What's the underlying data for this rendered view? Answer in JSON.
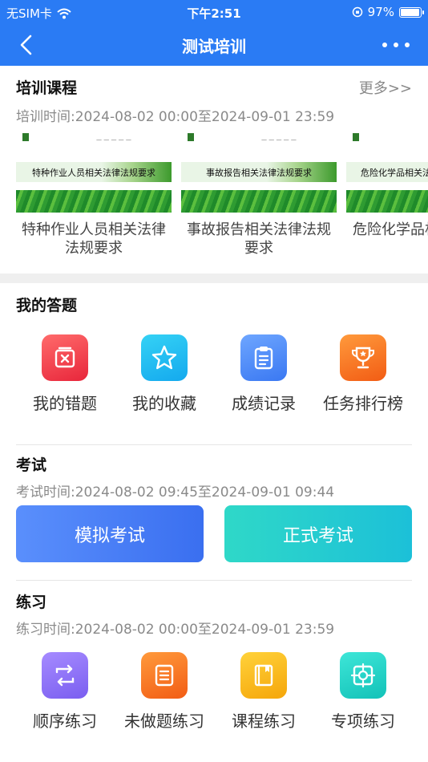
{
  "status_bar": {
    "carrier": "无SIM卡",
    "time": "下午2:51",
    "battery_pct": "97%",
    "battery_level": 0.97
  },
  "nav": {
    "title": "测试培训"
  },
  "training": {
    "title": "培训课程",
    "more_label": "更多>>",
    "time_text": "培训时间:2024-08-02 00:00至2024-09-01 23:59",
    "courses": [
      {
        "poster_title": "特种作业人员相关法律法规要求",
        "name": "特种作业人员相关法律法规要求"
      },
      {
        "poster_title": "事故报告相关法律法规要求",
        "name": "事故报告相关法律法规要求"
      },
      {
        "poster_title": "危险化学品相关法",
        "name": "危险化学品相关法规"
      }
    ]
  },
  "my_answers": {
    "title": "我的答题",
    "items": [
      {
        "label": "我的错题",
        "icon": "wrong-answers-icon",
        "color_from": "#ff6b6b",
        "color_to": "#e8263b"
      },
      {
        "label": "我的收藏",
        "icon": "star-icon",
        "color_from": "#35d2f5",
        "color_to": "#14a9ee"
      },
      {
        "label": "成绩记录",
        "icon": "clipboard-icon",
        "color_from": "#6ea6ff",
        "color_to": "#3a78f2"
      },
      {
        "label": "任务排行榜",
        "icon": "trophy-icon",
        "color_from": "#ff9a3c",
        "color_to": "#f25c14"
      }
    ]
  },
  "exam": {
    "title": "考试",
    "time_text": "考试时间:2024-08-02 09:45至2024-09-01 09:44",
    "mock_label": "模拟考试",
    "formal_label": "正式考试"
  },
  "practice": {
    "title": "练习",
    "time_text": "练习时间:2024-08-02 00:00至2024-09-01 23:59",
    "items": [
      {
        "label": "顺序练习",
        "icon": "sequence-icon",
        "color_from": "#a68bff",
        "color_to": "#7a5ef0"
      },
      {
        "label": "未做题练习",
        "icon": "list-doc-icon",
        "color_from": "#ff9a3c",
        "color_to": "#f25c14"
      },
      {
        "label": "课程练习",
        "icon": "book-icon",
        "color_from": "#ffd23a",
        "color_to": "#f5a60a"
      },
      {
        "label": "专项练习",
        "icon": "target-icon",
        "color_from": "#3ee6d8",
        "color_to": "#12c2b8"
      }
    ]
  },
  "colors": {
    "primary": "#2a7bf4",
    "mock_from": "#5a8ffc",
    "mock_to": "#3a6ff0",
    "formal_from": "#2fd8c8",
    "formal_to": "#1cc0d8"
  }
}
